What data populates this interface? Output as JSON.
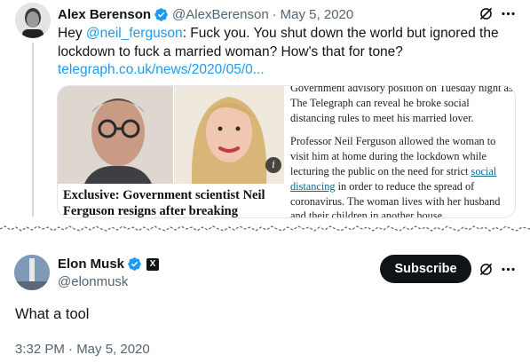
{
  "quoted_tweet": {
    "author_name": "Alex Berenson",
    "handle": "@AlexBerenson",
    "separator": "·",
    "date": "May 5, 2020",
    "text_before": "Hey ",
    "mention": "@neil_ferguson",
    "text_after": ": Fuck you. You shut down the world but ignored the lockdown to fuck a married woman? How's that for tone?",
    "link": "telegraph.co.uk/news/2020/05/0...",
    "verified_icon": "verified-badge-icon",
    "grok_icon": "grok-icon",
    "more_icon": "more-horizontal-icon"
  },
  "article_card": {
    "headline": "Exclusive: Government scientist Neil Ferguson resigns after breaking",
    "para1": "Government advisory position on Tuesday night as The Telegraph can reveal he broke social distancing rules to meet his married lover.",
    "para2_before": "Professor Neil Ferguson allowed the woman to visit him at home during the lockdown while lecturing the public on the need for strict ",
    "para2_link": "social distancing",
    "para2_after": " in order to reduce the spread of coronavirus. The woman lives with her husband and their children in another house.",
    "info_icon": "i"
  },
  "main_tweet": {
    "author_name": "Elon Musk",
    "handle": "@elonmusk",
    "badge_label": "X",
    "subscribe_label": "Subscribe",
    "text": "What a tool",
    "timestamp": "3:32 PM · May 5, 2020"
  },
  "colors": {
    "accent": "#1d9bf0",
    "text": "#0f1419",
    "muted": "#536471",
    "border": "#cfd9de"
  }
}
